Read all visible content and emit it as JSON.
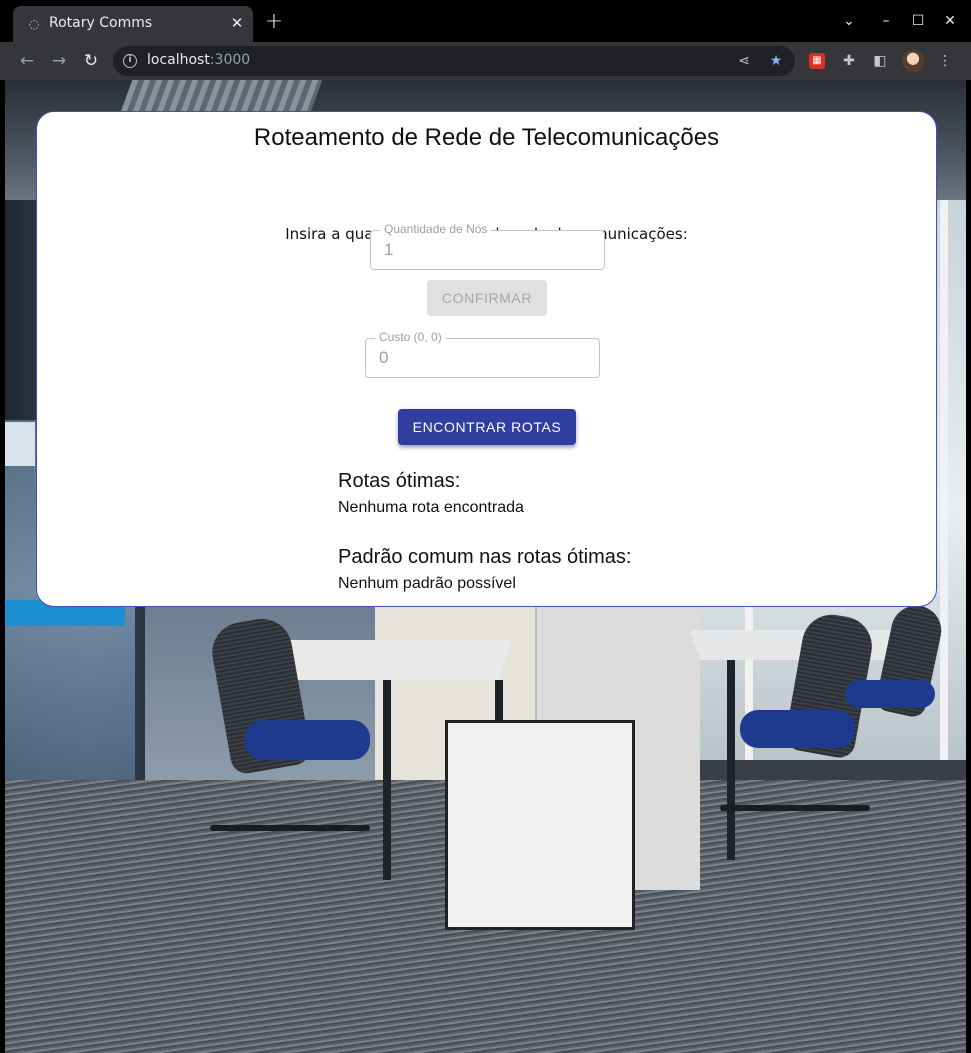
{
  "browser": {
    "tab_title": "Rotary Comms",
    "url_host": "localhost",
    "url_port": ":3000"
  },
  "app": {
    "title": "Roteamento de Rede de Telecomunicações",
    "nodes_prompt": "Insira a quantidade de nós da rede de comunicações:",
    "nodes_field": {
      "label": "Quantidade de Nós",
      "value": "1"
    },
    "confirm_label": "CONFIRMAR",
    "cost_field": {
      "label": "Custo (0, 0)",
      "value": "0"
    },
    "find_routes_label": "ENCONTRAR ROTAS",
    "optimal_routes": {
      "title": "Rotas ótimas:",
      "text": "Nenhuma rota encontrada"
    },
    "common_pattern": {
      "title": "Padrão comum nas rotas ótimas:",
      "text": "Nenhum padrão possível"
    }
  },
  "colors": {
    "primary": "#303f9f",
    "card_border": "#3f51b5",
    "disabled_bg": "#e0e0e0"
  }
}
